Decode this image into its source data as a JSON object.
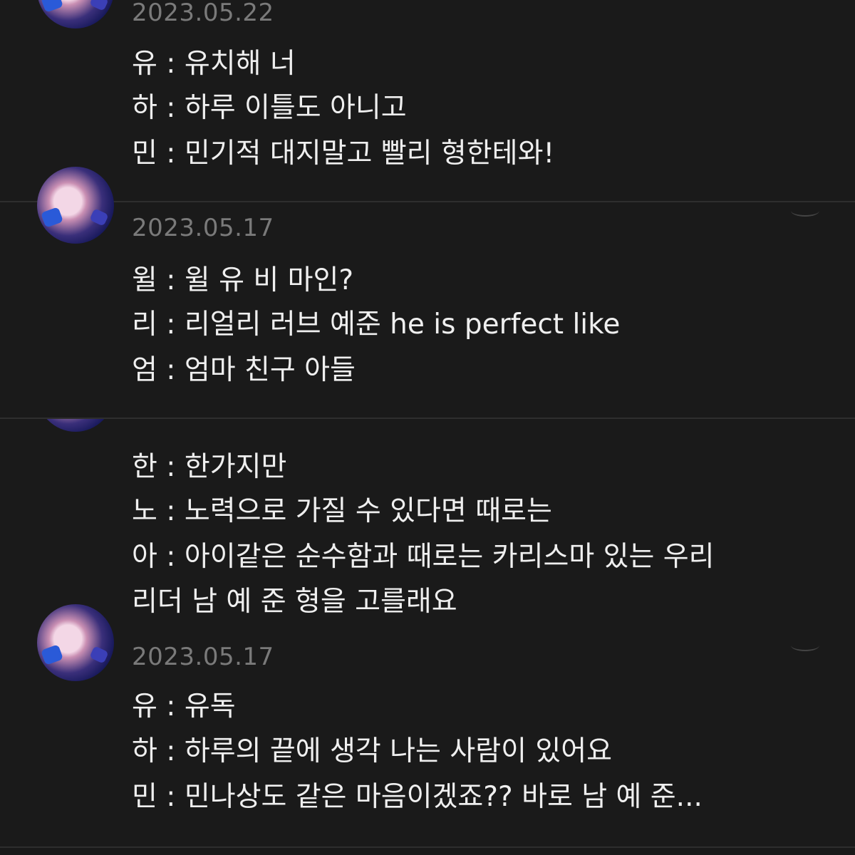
{
  "comments": [
    {
      "date": "2023.05.22",
      "lines": [
        "유 : 유치해 너",
        "하 : 하루 이틀도 아니고",
        "민 : 민기적 대지말고 빨리 형한테와!"
      ]
    },
    {
      "date": "2023.05.17",
      "lines": [
        "윌 : 윌 유 비 마인?",
        "리 : 리얼리 러브 예준 he is perfect like",
        "엄 : 엄마 친구 아들"
      ]
    },
    {
      "date": "",
      "lines": [
        "한 : 한가지만",
        "노 : 노력으로 가질 수 있다면 때로는",
        "아 : 아이같은 순수함과 때로는 카리스마 있는 우리",
        "리더 남 예 준 형을 고를래요"
      ]
    },
    {
      "date": "2023.05.17",
      "lines": [
        "유 : 유독",
        "하 : 하루의 끝에 생각 나는 사람이 있어요",
        "민 : 민나상도 같은 마음이겠죠?? 바로 남 예 준..."
      ]
    }
  ]
}
